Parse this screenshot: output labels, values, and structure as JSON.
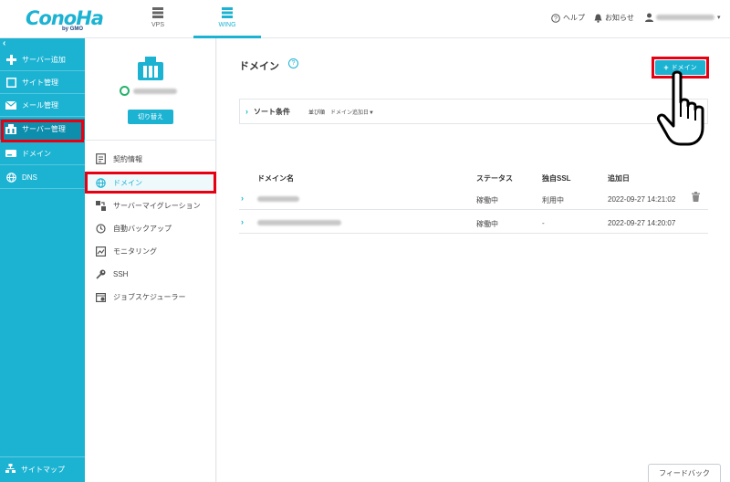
{
  "header": {
    "logo_text": "ConoHa",
    "logo_sub": "by GMO",
    "tabs": [
      {
        "label": "VPS",
        "icon": "server-stack-icon"
      },
      {
        "label": "WING",
        "icon": "server-stack-icon"
      }
    ],
    "help_label": "ヘルプ",
    "notice_label": "お知らせ"
  },
  "sidebar": {
    "items": [
      {
        "label": "サーバー追加",
        "icon": "plus-icon"
      },
      {
        "label": "サイト管理",
        "icon": "window-icon"
      },
      {
        "label": "メール管理",
        "icon": "envelope-icon"
      },
      {
        "label": "サーバー管理",
        "icon": "server-icon"
      },
      {
        "label": "ドメイン",
        "icon": "domain-card-icon"
      },
      {
        "label": "DNS",
        "icon": "globe-icon"
      }
    ],
    "sitemap_label": "サイトマップ"
  },
  "subbar": {
    "switch_label": "切り替え",
    "items": [
      {
        "label": "契約情報",
        "icon": "contract-icon"
      },
      {
        "label": "ドメイン",
        "icon": "globe-icon"
      },
      {
        "label": "サーバーマイグレーション",
        "icon": "migration-icon"
      },
      {
        "label": "自動バックアップ",
        "icon": "backup-icon"
      },
      {
        "label": "モニタリング",
        "icon": "monitor-icon"
      },
      {
        "label": "SSH",
        "icon": "key-icon"
      },
      {
        "label": "ジョブスケジューラー",
        "icon": "scheduler-icon"
      }
    ]
  },
  "main": {
    "title": "ドメイン",
    "help_mark": "?",
    "add_button": "ドメイン",
    "sort_label": "ソート条件",
    "sort_order_label": "並び順",
    "sort_value": "ドメイン追加日▼",
    "columns": [
      "ドメイン名",
      "ステータス",
      "独自SSL",
      "追加日"
    ],
    "rows": [
      {
        "status": "稼働中",
        "ssl": "利用中",
        "date": "2022-09-27 14:21:02"
      },
      {
        "status": "稼働中",
        "ssl": "-",
        "date": "2022-09-27 14:20:07"
      }
    ]
  },
  "feedback_label": "フィードバック",
  "colors": {
    "accent": "#1cb3d3",
    "active": "#0d8ead",
    "highlight": "#e60012"
  }
}
